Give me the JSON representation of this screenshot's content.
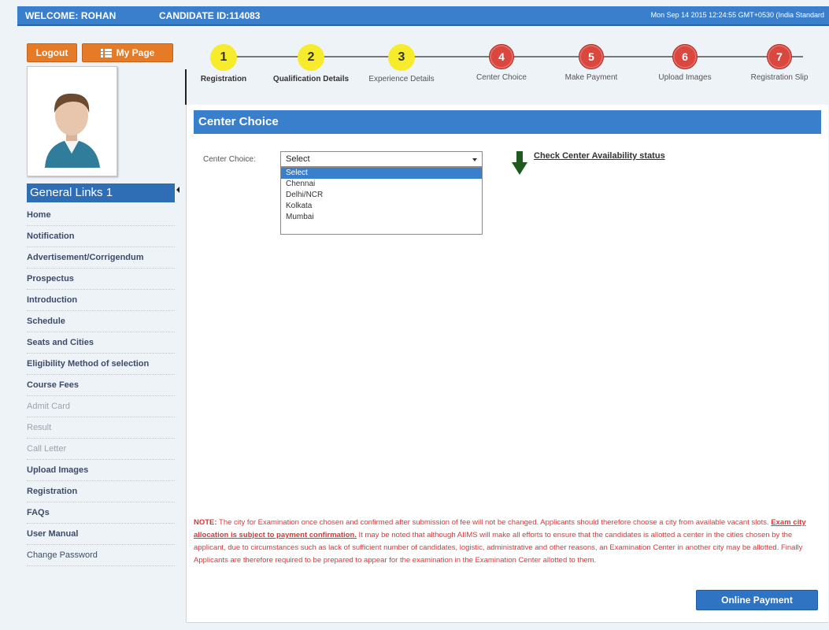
{
  "header": {
    "welcome": "WELCOME: ROHAN",
    "candidate": "CANDIDATE ID:114083",
    "datetime": "Mon Sep 14 2015 12:24:55 GMT+0530 (India Standard"
  },
  "sidebar": {
    "logout_label": "Logout",
    "mypage_label": "My Page",
    "general_links_title": "General Links 1",
    "links": [
      {
        "label": "Home"
      },
      {
        "label": "Notification"
      },
      {
        "label": "Advertisement/Corrigendum"
      },
      {
        "label": "Prospectus"
      },
      {
        "label": "Introduction"
      },
      {
        "label": "Schedule"
      },
      {
        "label": "Seats and Cities"
      },
      {
        "label": "Eligibility Method of selection"
      },
      {
        "label": "Course Fees"
      },
      {
        "label": "Admit Card"
      },
      {
        "label": "Result"
      },
      {
        "label": "Call Letter"
      },
      {
        "label": "Upload Images"
      },
      {
        "label": "Registration"
      },
      {
        "label": "FAQs"
      },
      {
        "label": "User Manual"
      },
      {
        "label": "Change Password"
      }
    ]
  },
  "steps": [
    {
      "num": "1",
      "label": "Registration",
      "status": "done"
    },
    {
      "num": "2",
      "label": "Qualification Details",
      "status": "done"
    },
    {
      "num": "3",
      "label": "Experience Details",
      "status": "done"
    },
    {
      "num": "4",
      "label": "Center Choice",
      "status": "todo"
    },
    {
      "num": "5",
      "label": "Make Payment",
      "status": "todo"
    },
    {
      "num": "6",
      "label": "Upload Images",
      "status": "todo"
    },
    {
      "num": "7",
      "label": "Registration Slip",
      "status": "todo"
    }
  ],
  "main": {
    "section_title": "Center Choice",
    "center_choice_label": "Center Choice:",
    "selected": "Select",
    "options": [
      "Select",
      "Chennai",
      "Delhi/NCR",
      "Kolkata",
      "Mumbai"
    ],
    "availability_link": "Check Center Availability status",
    "note_prefix": "NOTE:",
    "note_part1": " The city for Examination once chosen and confirmed after submission of fee will not be changed. Applicants should therefore choose a city from available vacant slots. ",
    "note_emph": "Exam city allocation is subject to payment confirmation.",
    "note_part2": " It may be noted that although AIIMS will make all efforts to ensure that the candidates is allotted a center in the cities chosen by the applicant, due to circumstances such as lack of sufficient number of candidates, logistic, administrative and other reasons, an Examination Center in another city may be allotted. Finally Applicants are therefore required to be prepared to appear for the examination in the Examination Center allotted to them.",
    "pay_label": "Online Payment"
  },
  "colors": {
    "header_blue": "#3a7fcb",
    "orange": "#e57b26",
    "step_done": "#f7ec2b",
    "step_todo": "#d9473f",
    "note_red": "#e03434"
  }
}
